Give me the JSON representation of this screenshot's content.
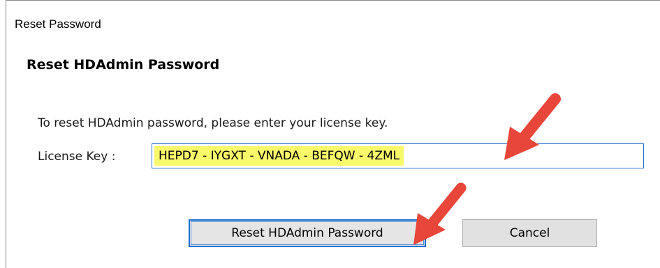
{
  "window": {
    "title": "Reset Password"
  },
  "dialog": {
    "heading": "Reset HDAdmin Password",
    "instruction": "To reset HDAdmin password, please enter your license key.",
    "license_label": "License Key :",
    "license_value": "HEPD7 - IYGXT - VNADA - BEFQW - 4ZML",
    "reset_button": "Reset HDAdmin Password",
    "cancel_button": "Cancel"
  },
  "annotations": {
    "arrow_color": "#e8463a",
    "highlight_color": "#f8f86b"
  }
}
